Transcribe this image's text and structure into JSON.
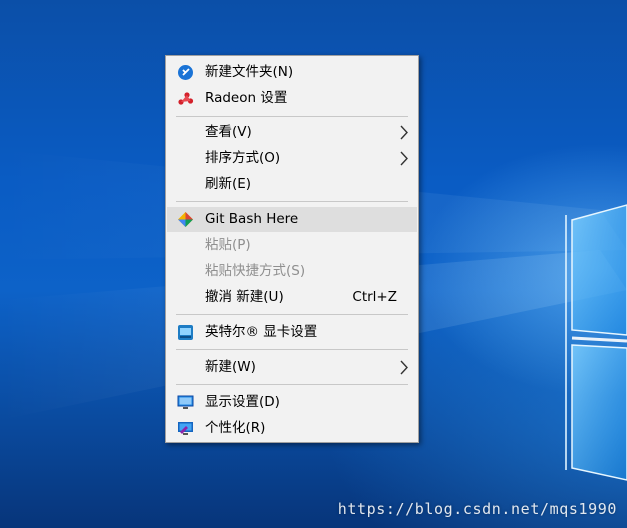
{
  "menu": {
    "items": [
      {
        "label": "新建文件夹(N)",
        "icon": "new-folder-icon"
      },
      {
        "label": "Radeon 设置",
        "icon": "radeon-icon"
      },
      {
        "label": "查看(V)",
        "submenu": true
      },
      {
        "label": "排序方式(O)",
        "submenu": true
      },
      {
        "label": "刷新(E)"
      },
      {
        "label": "Git Bash Here",
        "icon": "git-icon",
        "highlighted": true
      },
      {
        "label": "粘贴(P)",
        "disabled": true
      },
      {
        "label": "粘贴快捷方式(S)",
        "disabled": true
      },
      {
        "label": "撤消 新建(U)",
        "shortcut": "Ctrl+Z"
      },
      {
        "label": "英特尔® 显卡设置",
        "icon": "intel-graphics-icon"
      },
      {
        "label": "新建(W)",
        "submenu": true
      },
      {
        "label": "显示设置(D)",
        "icon": "display-icon"
      },
      {
        "label": "个性化(R)",
        "icon": "personalize-icon"
      }
    ]
  },
  "watermark": "https://blog.csdn.net/mqs1990",
  "colors": {
    "menu_background": "#f2f2f2",
    "highlight": "#dedede",
    "disabled_text": "#8f8f8f",
    "desktop_blue": "#0d62c8"
  }
}
